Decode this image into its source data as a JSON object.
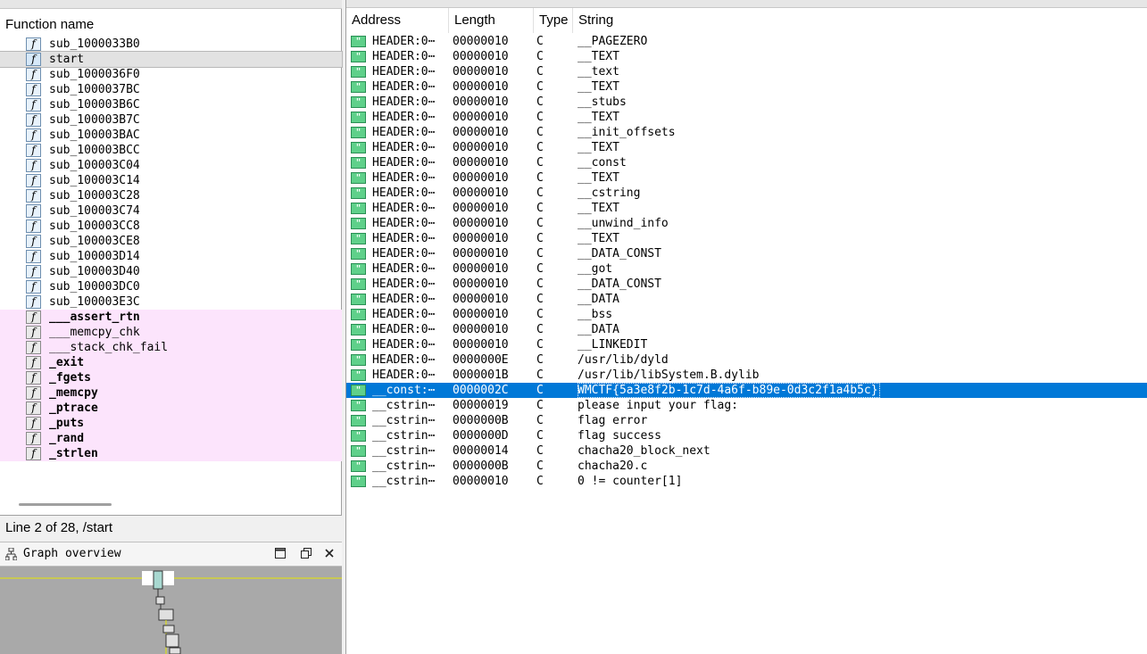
{
  "functions_panel": {
    "header": "Function name",
    "items": [
      {
        "name": "sub_1000033B0",
        "kind": "normal"
      },
      {
        "name": "start",
        "kind": "selected"
      },
      {
        "name": "sub_1000036F0",
        "kind": "normal"
      },
      {
        "name": "sub_1000037BC",
        "kind": "normal"
      },
      {
        "name": "sub_100003B6C",
        "kind": "normal"
      },
      {
        "name": "sub_100003B7C",
        "kind": "normal"
      },
      {
        "name": "sub_100003BAC",
        "kind": "normal"
      },
      {
        "name": "sub_100003BCC",
        "kind": "normal"
      },
      {
        "name": "sub_100003C04",
        "kind": "normal"
      },
      {
        "name": "sub_100003C14",
        "kind": "normal"
      },
      {
        "name": "sub_100003C28",
        "kind": "normal"
      },
      {
        "name": "sub_100003C74",
        "kind": "normal"
      },
      {
        "name": "sub_100003CC8",
        "kind": "normal"
      },
      {
        "name": "sub_100003CE8",
        "kind": "normal"
      },
      {
        "name": "sub_100003D14",
        "kind": "normal"
      },
      {
        "name": "sub_100003D40",
        "kind": "normal"
      },
      {
        "name": "sub_100003DC0",
        "kind": "normal"
      },
      {
        "name": "sub_100003E3C",
        "kind": "normal"
      },
      {
        "name": "___assert_rtn",
        "kind": "library"
      },
      {
        "name": "___memcpy_chk",
        "kind": "library-light"
      },
      {
        "name": "___stack_chk_fail",
        "kind": "library-light"
      },
      {
        "name": "_exit",
        "kind": "library"
      },
      {
        "name": "_fgets",
        "kind": "library"
      },
      {
        "name": "_memcpy",
        "kind": "library"
      },
      {
        "name": "_ptrace",
        "kind": "library"
      },
      {
        "name": "_puts",
        "kind": "library"
      },
      {
        "name": "_rand",
        "kind": "library"
      },
      {
        "name": "_strlen",
        "kind": "library"
      }
    ],
    "function_icon_glyph": "f",
    "status": "Line 2 of 28, /start"
  },
  "graph_overview": {
    "title": "Graph overview",
    "icon": "graph-tree-icon",
    "buttons": [
      "maximize-icon",
      "restore-icon",
      "close-icon"
    ]
  },
  "strings_panel": {
    "columns": {
      "address": "Address",
      "length": "Length",
      "type": "Type",
      "string": "String"
    },
    "string_icon_glyph": "\"",
    "selected_color": "#0078d7",
    "rows": [
      {
        "address": "HEADER:0⋯",
        "length": "00000010",
        "type": "C",
        "string": "__PAGEZERO"
      },
      {
        "address": "HEADER:0⋯",
        "length": "00000010",
        "type": "C",
        "string": "__TEXT"
      },
      {
        "address": "HEADER:0⋯",
        "length": "00000010",
        "type": "C",
        "string": "__text"
      },
      {
        "address": "HEADER:0⋯",
        "length": "00000010",
        "type": "C",
        "string": "__TEXT"
      },
      {
        "address": "HEADER:0⋯",
        "length": "00000010",
        "type": "C",
        "string": "__stubs"
      },
      {
        "address": "HEADER:0⋯",
        "length": "00000010",
        "type": "C",
        "string": "__TEXT"
      },
      {
        "address": "HEADER:0⋯",
        "length": "00000010",
        "type": "C",
        "string": "__init_offsets"
      },
      {
        "address": "HEADER:0⋯",
        "length": "00000010",
        "type": "C",
        "string": "__TEXT"
      },
      {
        "address": "HEADER:0⋯",
        "length": "00000010",
        "type": "C",
        "string": "__const"
      },
      {
        "address": "HEADER:0⋯",
        "length": "00000010",
        "type": "C",
        "string": "__TEXT"
      },
      {
        "address": "HEADER:0⋯",
        "length": "00000010",
        "type": "C",
        "string": "__cstring"
      },
      {
        "address": "HEADER:0⋯",
        "length": "00000010",
        "type": "C",
        "string": "__TEXT"
      },
      {
        "address": "HEADER:0⋯",
        "length": "00000010",
        "type": "C",
        "string": "__unwind_info"
      },
      {
        "address": "HEADER:0⋯",
        "length": "00000010",
        "type": "C",
        "string": "__TEXT"
      },
      {
        "address": "HEADER:0⋯",
        "length": "00000010",
        "type": "C",
        "string": "__DATA_CONST"
      },
      {
        "address": "HEADER:0⋯",
        "length": "00000010",
        "type": "C",
        "string": "__got"
      },
      {
        "address": "HEADER:0⋯",
        "length": "00000010",
        "type": "C",
        "string": "__DATA_CONST"
      },
      {
        "address": "HEADER:0⋯",
        "length": "00000010",
        "type": "C",
        "string": "__DATA"
      },
      {
        "address": "HEADER:0⋯",
        "length": "00000010",
        "type": "C",
        "string": "__bss"
      },
      {
        "address": "HEADER:0⋯",
        "length": "00000010",
        "type": "C",
        "string": "__DATA"
      },
      {
        "address": "HEADER:0⋯",
        "length": "00000010",
        "type": "C",
        "string": "__LINKEDIT"
      },
      {
        "address": "HEADER:0⋯",
        "length": "0000000E",
        "type": "C",
        "string": "/usr/lib/dyld"
      },
      {
        "address": "HEADER:0⋯",
        "length": "0000001B",
        "type": "C",
        "string": "/usr/lib/libSystem.B.dylib"
      },
      {
        "address": "__const:⋯",
        "length": "0000002C",
        "type": "C",
        "string": "WMCTF{5a3e8f2b-1c7d-4a6f-b89e-0d3c2f1a4b5c}",
        "selected": true
      },
      {
        "address": "__cstrin⋯",
        "length": "00000019",
        "type": "C",
        "string": "please input your flag:"
      },
      {
        "address": "__cstrin⋯",
        "length": "0000000B",
        "type": "C",
        "string": "flag error"
      },
      {
        "address": "__cstrin⋯",
        "length": "0000000D",
        "type": "C",
        "string": "flag success"
      },
      {
        "address": "__cstrin⋯",
        "length": "00000014",
        "type": "C",
        "string": "chacha20_block_next"
      },
      {
        "address": "__cstrin⋯",
        "length": "0000000B",
        "type": "C",
        "string": "chacha20.c"
      },
      {
        "address": "__cstrin⋯",
        "length": "00000010",
        "type": "C",
        "string": "0 != counter[1]"
      }
    ]
  }
}
